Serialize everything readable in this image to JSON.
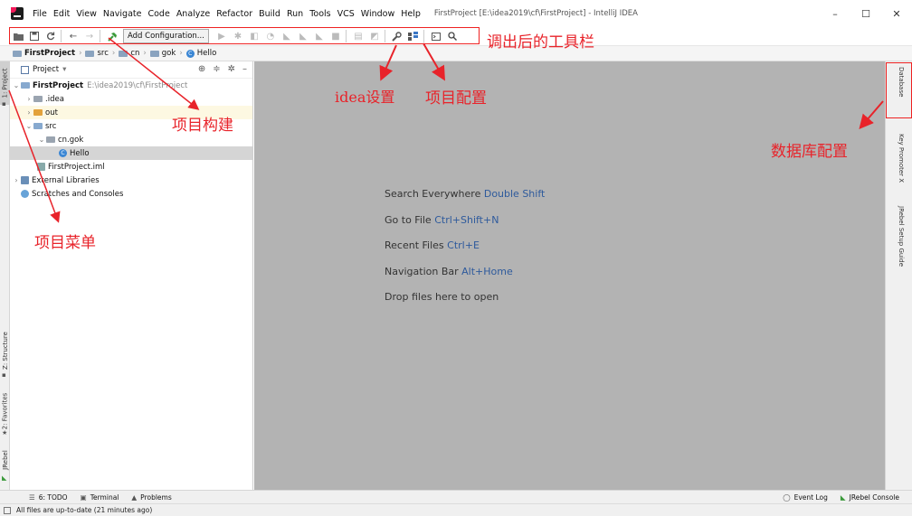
{
  "menubar": {
    "items": [
      "File",
      "Edit",
      "View",
      "Navigate",
      "Code",
      "Analyze",
      "Refactor",
      "Build",
      "Run",
      "Tools",
      "VCS",
      "Window",
      "Help"
    ],
    "window_title": "FirstProject [E:\\idea2019\\cf\\FirstProject] - IntelliJ IDEA",
    "controls": {
      "minimize": "–",
      "maximize": "☐",
      "close": "✕"
    }
  },
  "toolbar": {
    "add_configuration": "Add Configuration..."
  },
  "breadcrumb": {
    "items": [
      "FirstProject",
      "src",
      "cn",
      "gok",
      "Hello"
    ]
  },
  "left_strip": {
    "project_tab": "1: Project",
    "structure_tab": "Z: Structure",
    "favorites_tab": "2: Favorites",
    "jrebel_tab": "JRebel"
  },
  "project_panel": {
    "title": "Project",
    "tree": {
      "root": "FirstProject",
      "root_path": "E:\\idea2019\\cf\\FirstProject",
      "idea": ".idea",
      "out": "out",
      "src": "src",
      "package": "cn.gok",
      "class": "Hello",
      "iml": "FirstProject.iml",
      "libraries": "External Libraries",
      "scratches": "Scratches and Consoles"
    }
  },
  "editor": {
    "hints": [
      {
        "text": "Search Everywhere",
        "key": "Double Shift"
      },
      {
        "text": "Go to File",
        "key": "Ctrl+Shift+N"
      },
      {
        "text": "Recent Files",
        "key": "Ctrl+E"
      },
      {
        "text": "Navigation Bar",
        "key": "Alt+Home"
      },
      {
        "text": "Drop files here to open",
        "key": ""
      }
    ]
  },
  "right_strip": {
    "database_tab": "Database",
    "key_promoter_tab": "Key Promoter X",
    "jrebel_setup_tab": "JRebel Setup Guide"
  },
  "bottom_bar": {
    "todo": "6: TODO",
    "terminal": "Terminal",
    "problems": "Problems",
    "event_log": "Event Log",
    "jrebel_console": "JRebel Console"
  },
  "status_bar": {
    "message": "All files are up-to-date (21 minutes ago)"
  },
  "annotations": {
    "toolbar_note": "调出后的工具栏",
    "build_note": "项目构建",
    "settings_note": "idea设置",
    "project_config_note": "项目配置",
    "database_note": "数据库配置",
    "project_menu_note": "项目菜单"
  },
  "colors": {
    "annotation_red": "#e8232a",
    "editor_background": "#b3b3b3",
    "shortcut_blue": "#2e5a9c"
  }
}
